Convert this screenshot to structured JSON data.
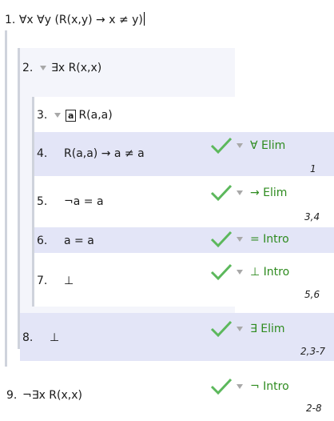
{
  "premise": {
    "number": "1.",
    "formula": "∀x ∀y (R(x,y) → x ≠ y)"
  },
  "lines": [
    {
      "number": "2.",
      "formula": "∃x R(x,x)"
    },
    {
      "number": "3.",
      "box_var": "a",
      "formula": "R(a,a)"
    },
    {
      "number": "4.",
      "formula": "R(a,a) → a ≠ a",
      "rule": "∀ Elim",
      "refs": "1"
    },
    {
      "number": "5.",
      "formula": "¬a = a",
      "rule": "→ Elim",
      "refs": "3,4"
    },
    {
      "number": "6.",
      "formula": "a = a",
      "rule": "= Intro",
      "refs": ""
    },
    {
      "number": "7.",
      "formula": "⊥",
      "rule": "⊥ Intro",
      "refs": "5,6"
    },
    {
      "number": "8.",
      "formula": "⊥",
      "rule": "∃ Elim",
      "refs": "2,3-7"
    },
    {
      "number": "9.",
      "formula": "¬∃x R(x,x)",
      "rule": "¬ Intro",
      "refs": "2-8"
    }
  ],
  "colors": {
    "check": "#5cb85c",
    "rule": "#2e8b1f",
    "highlight": "#e3e5f7",
    "subproof": "#f4f5fb"
  },
  "icons": [
    "checkmark-icon",
    "dropdown-triangle-icon"
  ]
}
